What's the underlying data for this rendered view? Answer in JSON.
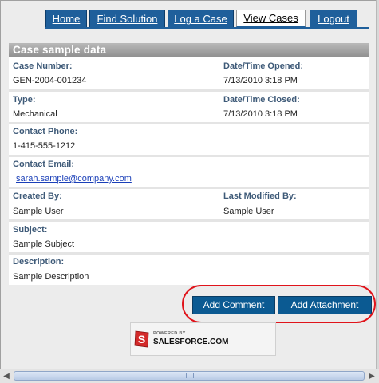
{
  "nav": {
    "tabs": [
      {
        "label": "Home"
      },
      {
        "label": "Find Solution"
      },
      {
        "label": "Log a Case"
      },
      {
        "label": "View Cases"
      },
      {
        "label": "Logout"
      }
    ],
    "active_tab": "View Cases"
  },
  "case": {
    "title": "Case sample data",
    "case_number_label": "Case Number:",
    "case_number": "GEN-2004-001234",
    "opened_label": "Date/Time Opened:",
    "opened": "7/13/2010 3:18 PM",
    "type_label": "Type:",
    "type": "Mechanical",
    "closed_label": "Date/Time Closed:",
    "closed": "7/13/2010 3:18 PM",
    "phone_label": "Contact Phone:",
    "phone": "1-415-555-1212",
    "email_label": "Contact Email:",
    "email": "sarah.sample@company.com",
    "created_by_label": "Created By:",
    "created_by": "Sample User",
    "modified_by_label": "Last Modified By:",
    "modified_by": "Sample User",
    "subject_label": "Subject:",
    "subject": "Sample Subject",
    "description_label": "Description:",
    "description": "Sample Description"
  },
  "actions": {
    "add_comment": "Add Comment",
    "add_attachment": "Add Attachment"
  },
  "footer": {
    "powered_by": "POWERED BY",
    "brand": "SALESFORCE.COM"
  },
  "colors": {
    "tab_bg": "#1f5f9b",
    "button_bg": "#0b5a92",
    "label_text": "#3e5a78",
    "highlight_ellipse": "#e0141b"
  }
}
